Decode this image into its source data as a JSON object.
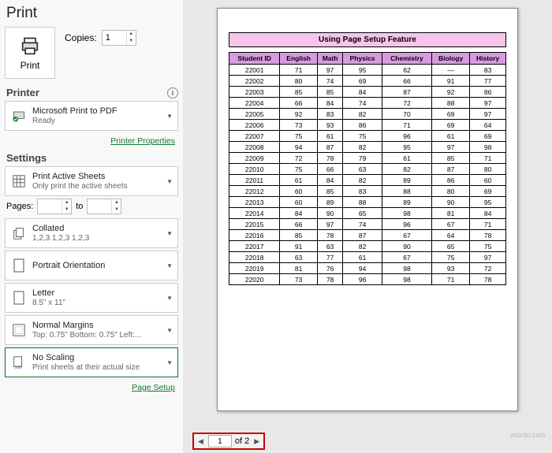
{
  "title": "Print",
  "printBtn": "Print",
  "copiesLabel": "Copies:",
  "copiesValue": "1",
  "printer": {
    "header": "Printer",
    "name": "Microsoft Print to PDF",
    "status": "Ready",
    "propsLink": "Printer Properties"
  },
  "settings": {
    "header": "Settings",
    "sheets": {
      "l1": "Print Active Sheets",
      "l2": "Only print the active sheets"
    },
    "pagesLabel": "Pages:",
    "toLabel": "to",
    "collated": {
      "l1": "Collated",
      "l2": "1,2,3    1,2,3    1,2,3"
    },
    "orient": {
      "l1": "Portrait Orientation",
      "l2": ""
    },
    "paper": {
      "l1": "Letter",
      "l2": "8.5\" x 11\""
    },
    "margins": {
      "l1": "Normal Margins",
      "l2": "Top: 0.75\" Bottom: 0.75\" Left:..."
    },
    "scaling": {
      "l1": "No Scaling",
      "l2": "Print sheets at their actual size"
    },
    "pageSetupLink": "Page Setup"
  },
  "preview": {
    "title": "Using Page Setup Feature",
    "cols": [
      "Student ID",
      "English",
      "Math",
      "Physics",
      "Chemistry",
      "Biology",
      "History"
    ],
    "rows": [
      [
        "22001",
        "71",
        "97",
        "95",
        "62",
        "—",
        "83"
      ],
      [
        "22002",
        "80",
        "74",
        "69",
        "66",
        "91",
        "77"
      ],
      [
        "22003",
        "85",
        "85",
        "84",
        "87",
        "92",
        "86"
      ],
      [
        "22004",
        "66",
        "84",
        "74",
        "72",
        "88",
        "97"
      ],
      [
        "22005",
        "92",
        "83",
        "82",
        "70",
        "69",
        "97"
      ],
      [
        "22006",
        "73",
        "93",
        "86",
        "71",
        "69",
        "64"
      ],
      [
        "22007",
        "75",
        "61",
        "75",
        "96",
        "61",
        "69"
      ],
      [
        "22008",
        "94",
        "87",
        "82",
        "95",
        "97",
        "98"
      ],
      [
        "22009",
        "72",
        "78",
        "79",
        "61",
        "85",
        "71"
      ],
      [
        "22010",
        "75",
        "66",
        "63",
        "82",
        "87",
        "80"
      ],
      [
        "22011",
        "61",
        "84",
        "82",
        "89",
        "86",
        "60"
      ],
      [
        "22012",
        "60",
        "85",
        "83",
        "88",
        "80",
        "69"
      ],
      [
        "22013",
        "60",
        "89",
        "88",
        "89",
        "90",
        "95"
      ],
      [
        "22014",
        "84",
        "90",
        "65",
        "98",
        "81",
        "84"
      ],
      [
        "22015",
        "66",
        "97",
        "74",
        "96",
        "67",
        "71"
      ],
      [
        "22016",
        "85",
        "78",
        "87",
        "67",
        "64",
        "78"
      ],
      [
        "22017",
        "91",
        "63",
        "82",
        "90",
        "65",
        "75"
      ],
      [
        "22018",
        "63",
        "77",
        "61",
        "67",
        "75",
        "97"
      ],
      [
        "22019",
        "81",
        "76",
        "94",
        "98",
        "93",
        "72"
      ],
      [
        "22020",
        "73",
        "78",
        "96",
        "98",
        "71",
        "78"
      ]
    ],
    "navCurrent": "1",
    "navOf": "of 2"
  },
  "watermark": "wsxdn.com"
}
